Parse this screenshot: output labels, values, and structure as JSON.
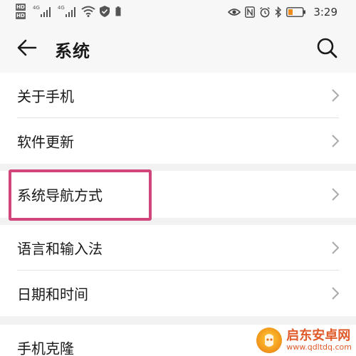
{
  "status_bar": {
    "hd_badges": [
      "HD",
      "HD"
    ],
    "network_labels": [
      "4G",
      "4G"
    ],
    "time": "3:29"
  },
  "header": {
    "title": "系统"
  },
  "settings": [
    {
      "label": "关于手机"
    },
    {
      "label": "软件更新"
    },
    {
      "label": "系统导航方式"
    },
    {
      "label": "语言和输入法"
    },
    {
      "label": "日期和时间"
    },
    {
      "label": "手机克隆"
    }
  ],
  "icons": {
    "back": "back-arrow-icon",
    "search": "search-icon",
    "chevron": "chevron-right-icon"
  },
  "colors": {
    "highlight": "#d0457a",
    "page_bg": "#f2f2f2",
    "card_bg": "#ffffff"
  },
  "watermark": {
    "title": "启东安卓网",
    "url": "www.qdltdq.com"
  }
}
